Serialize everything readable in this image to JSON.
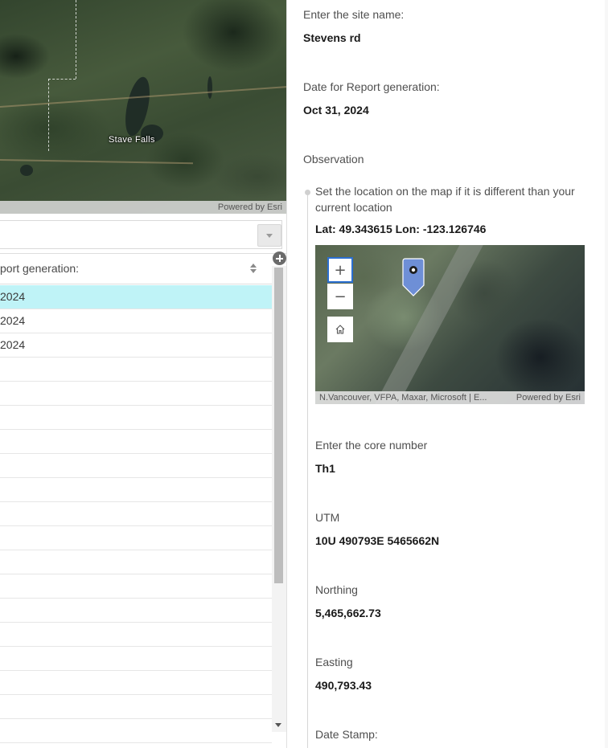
{
  "main_map": {
    "place_label": "Stave Falls",
    "attribution": "Powered by Esri"
  },
  "table": {
    "header_label": "port generation:",
    "rows": [
      "2024",
      "2024",
      "2024",
      "",
      "",
      "",
      "",
      "",
      "",
      "",
      "",
      "",
      "",
      "",
      "",
      "",
      "",
      "",
      ""
    ],
    "selected_row_index": 0
  },
  "form": {
    "site_name_label": "Enter the site name:",
    "site_name_value": "Stevens rd",
    "report_date_label": "Date for Report generation:",
    "report_date_value": "Oct 31, 2024",
    "observation_group_label": "Observation",
    "location_instruction": "Set the location on the map if it is different than your current location",
    "lat_lon_value": "Lat: 49.343615 Lon: -123.126746",
    "mini_map": {
      "zoom_in_symbol": "+",
      "zoom_out_symbol": "−",
      "attribution_left": "N.Vancouver, VFPA, Maxar, Microsoft | E...",
      "attribution_right": "Powered by Esri",
      "pin_color": "#6e8fd6"
    },
    "core_number_label": "Enter the core number",
    "core_number_value": "Th1",
    "utm_label": "UTM",
    "utm_value": "10U 490793E 5465662N",
    "northing_label": "Northing",
    "northing_value": "5,465,662.73",
    "easting_label": "Easting",
    "easting_value": "490,793.43",
    "date_stamp_label": "Date Stamp:"
  },
  "colors": {
    "selected_row": "#bff3f7",
    "accent_focus": "#2b6fd0"
  }
}
